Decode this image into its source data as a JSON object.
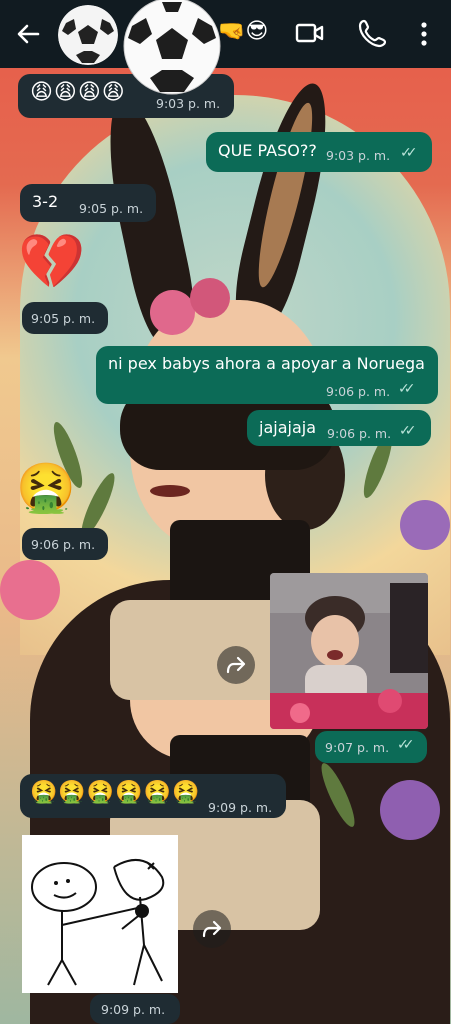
{
  "header": {
    "title_suffix": "🤜😎",
    "icons": [
      "back-arrow-icon",
      "soccer-ball-avatar",
      "soccer-ball-emoji",
      "video-call-icon",
      "phone-call-icon",
      "more-options-icon"
    ]
  },
  "messages": [
    {
      "direction": "incoming",
      "text": "😩😩😩😩",
      "time": "9:03 p. m."
    },
    {
      "direction": "outgoing",
      "text": "QUE PASO??",
      "time": "9:03 p. m.",
      "status": "read"
    },
    {
      "direction": "incoming",
      "text": "3-2",
      "time": "9:05 p. m."
    },
    {
      "direction": "incoming",
      "text": "💔",
      "time": "9:05 p. m."
    },
    {
      "direction": "outgoing",
      "text": "ni pex babys ahora a apoyar a Noruega",
      "time": "9:06 p. m.",
      "status": "read"
    },
    {
      "direction": "outgoing",
      "text": "jajajaja",
      "time": "9:06 p. m.",
      "status": "read"
    },
    {
      "direction": "incoming",
      "text": "🤮",
      "time": "9:06 p. m."
    },
    {
      "direction": "outgoing",
      "type": "image",
      "time": "9:07 p. m.",
      "status": "read"
    },
    {
      "direction": "incoming",
      "text": "🤮🤮🤮🤮🤮🤮",
      "time": "9:09 p. m."
    },
    {
      "direction": "incoming",
      "type": "sticker",
      "time": "9:09 p. m."
    }
  ],
  "colors": {
    "topbar": "#111b21",
    "incoming_bubble": "#1f2c33",
    "outgoing_bubble": "#0c6b57",
    "read_ticks": "#b9e3d8"
  }
}
